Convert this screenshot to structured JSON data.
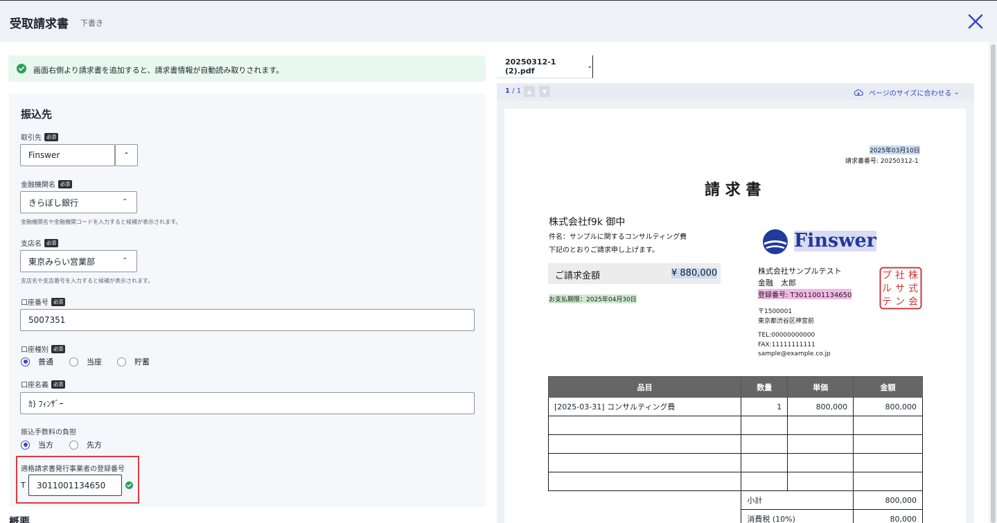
{
  "header": {
    "title": "受取請求書",
    "status": "下書き"
  },
  "notice": {
    "text": "画面右側より請求書を追加すると、請求書情報が自動読み取りされます。"
  },
  "form": {
    "section_title": "振込先",
    "required_label": "必須",
    "partner": {
      "label": "取引先",
      "value": "Finswer"
    },
    "bank": {
      "label": "金融機関名",
      "value": "きらぼし銀行",
      "hint": "金融機関名や金融機関コードを入力すると候補が表示されます。"
    },
    "branch": {
      "label": "支店名",
      "value": "東京みらい営業部",
      "hint": "支店名や支店番号を入力すると候補が表示されます。"
    },
    "account_number": {
      "label": "口座番号",
      "value": "5007351"
    },
    "account_type": {
      "label": "口座種別",
      "options": [
        "普通",
        "当座",
        "貯蓄"
      ],
      "selected": "普通"
    },
    "account_holder": {
      "label": "口座名義",
      "value": "ｶ) ﾌｨﾝｻﾞｰ"
    },
    "fee_bearer": {
      "label": "振込手数料の負担",
      "options": [
        "当方",
        "先方"
      ],
      "selected": "当方"
    },
    "registration": {
      "label": "適格請求書発行事業者の登録番号",
      "prefix": "T",
      "value": "3011001134650"
    },
    "next_section_title": "概要"
  },
  "viewer": {
    "file_name": "20250312-1 (2).pdf",
    "page_current": "1",
    "page_sep": " / ",
    "page_total": "1",
    "fit_label": "ページのサイズに合わせる",
    "colors": {
      "accent": "#3848c8"
    }
  },
  "invoice": {
    "date": "2025年03月10日",
    "number": "請求書番号: 20250312-1",
    "title": "請 求 書",
    "recipient": "株式会社f9k 御中",
    "subject": "件名：サンプルに関するコンサルティング費",
    "message": "下記のとおりご請求申し上げます。",
    "amount_label": "ご請求金額",
    "amount_value": "¥ 880,000",
    "due": "お支払期限：2025年04月30日",
    "logo_text": "Finswer",
    "issuer_company": "株式会社サンプルテスト",
    "issuer_person": "金融　太郎",
    "registration": "登録番号: T3011001134650",
    "postal": "〒1500001",
    "address": "東京都渋谷区神宮前",
    "tel": "TEL:00000000000",
    "fax": "FAX:11111111111",
    "email": "sample@example.co.jp",
    "seal_text": "株式会社サンプルテ",
    "table_headers": [
      "品目",
      "数量",
      "単価",
      "金額"
    ],
    "rows": [
      {
        "item": "[2025-03-31] コンサルティング費",
        "qty": "1",
        "price": "800,000",
        "amount": "800,000"
      }
    ],
    "subtotal_label": "小計",
    "subtotal_value": "800,000",
    "tax_label": "消費税 (10%)",
    "tax_value": "80,000"
  }
}
